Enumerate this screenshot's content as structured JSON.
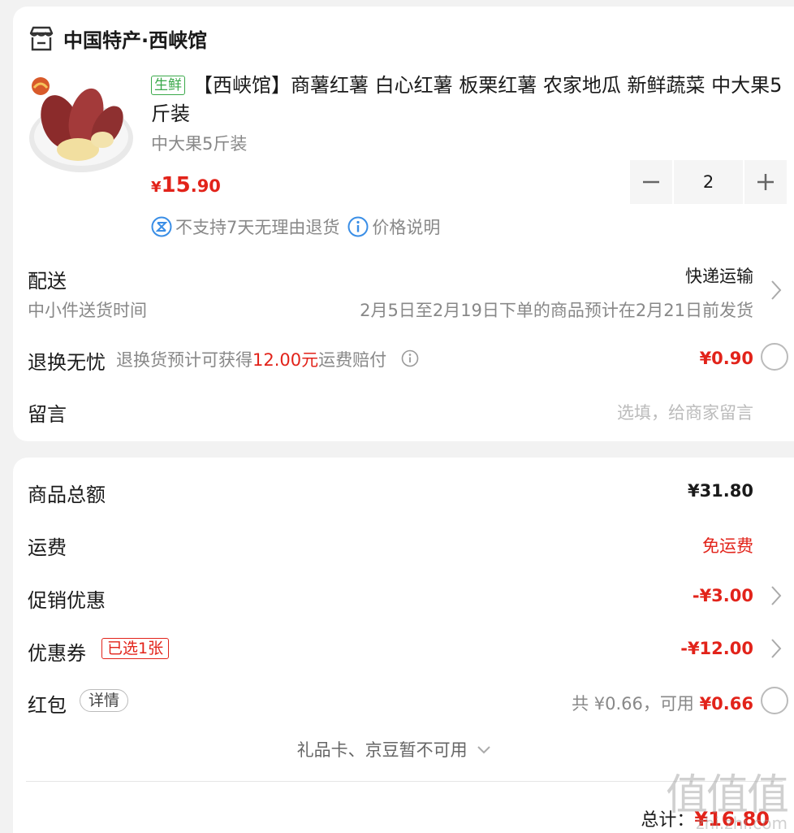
{
  "shop": {
    "icon": "store-icon",
    "name": "中国特产·西峡馆"
  },
  "product": {
    "tag": "生鲜",
    "title": "【西峡馆】商薯红薯 白心红薯 板栗红薯 农家地瓜 新鲜蔬菜 中大果5斤装",
    "spec": "中大果5斤装",
    "price_currency": "¥",
    "price_int": "15",
    "price_dec": ".90",
    "quantity": "2",
    "no_return_text": "不支持7天无理由退货",
    "price_info_text": "价格说明"
  },
  "delivery": {
    "label": "配送",
    "method": "快递运输",
    "sub_label": "中小件送货时间",
    "schedule": "2月5日至2月19日下单的商品预计在2月21日前发货"
  },
  "return_worry": {
    "label": "退换无忧",
    "desc_prefix": "退换货预计可获得",
    "desc_amount": "12.00元",
    "desc_suffix": "运费赔付",
    "price": "¥0.90"
  },
  "message": {
    "label": "留言",
    "placeholder": "选填，给商家留言"
  },
  "summary": {
    "goods_total_label": "商品总额",
    "goods_total_value": "¥31.80",
    "shipping_label": "运费",
    "shipping_value": "免运费",
    "promo_label": "促销优惠",
    "promo_value": "-¥3.00",
    "coupon_label": "优惠券",
    "coupon_tag": "已选1张",
    "coupon_value": "-¥12.00",
    "redpacket_label": "红包",
    "redpacket_tag": "详情",
    "redpacket_total": "共 ¥0.66，可用",
    "redpacket_value": "¥0.66",
    "giftcard_text": "礼品卡、京豆暂不可用",
    "total_label": "总计：",
    "total_value": "¥16.80"
  },
  "watermark": {
    "big": "值值值",
    "small": "zhi.zhi.com"
  },
  "colors": {
    "accent_red": "#e2231a",
    "fresh_green": "#3aa94a",
    "info_blue": "#3a8ee6"
  }
}
